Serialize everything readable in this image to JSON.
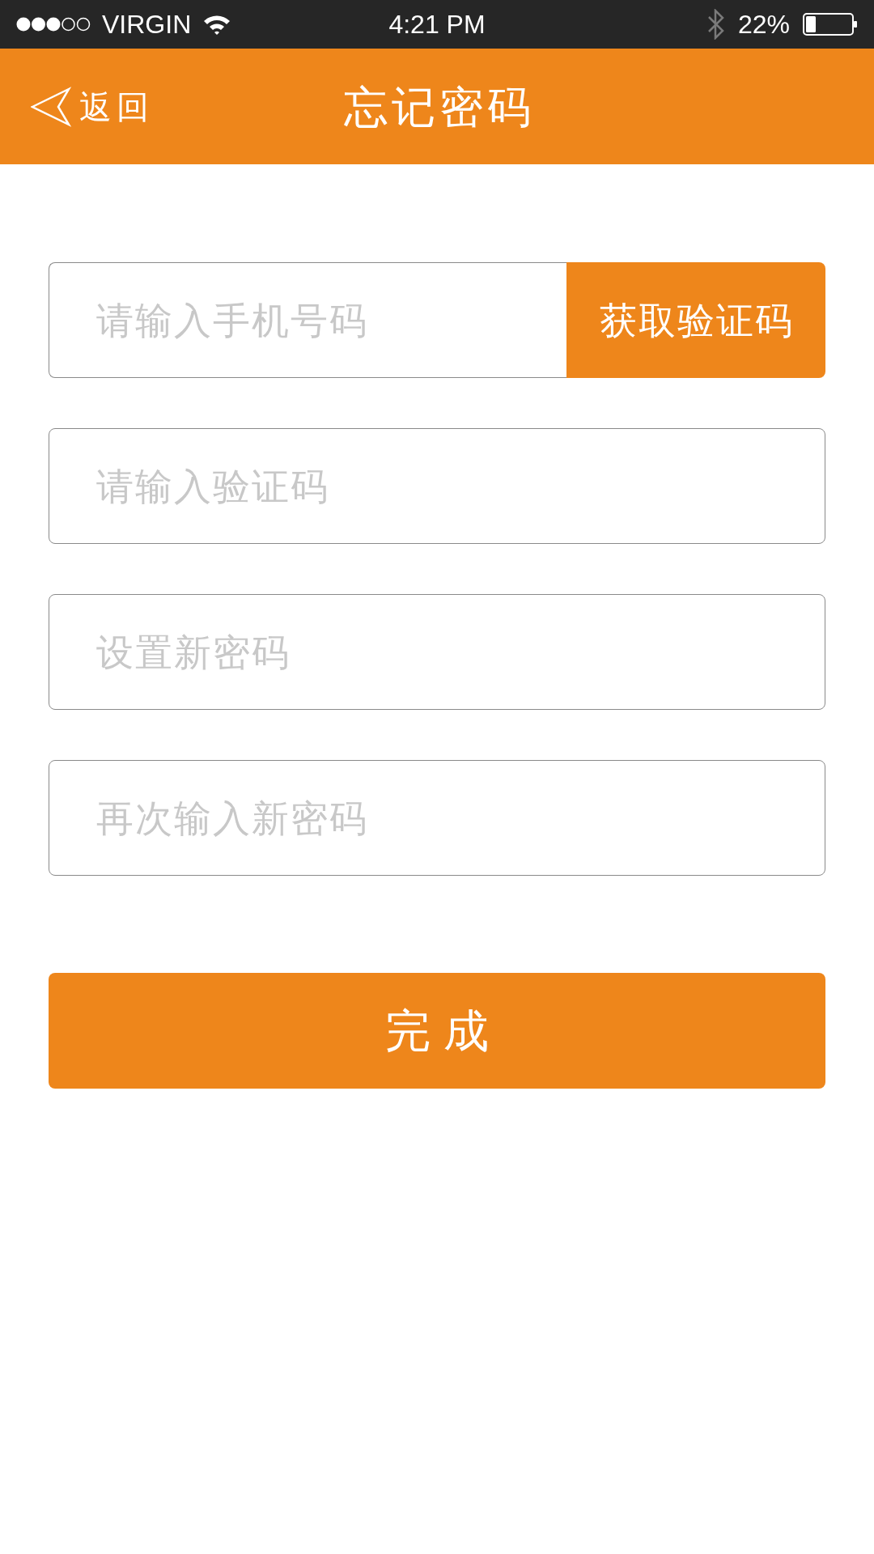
{
  "status_bar": {
    "carrier": "VIRGIN",
    "time": "4:21 PM",
    "battery": "22%"
  },
  "nav_bar": {
    "back": "返回",
    "title": "忘记密码"
  },
  "form": {
    "fields": [
      {
        "placeholder": "请输入手机号码",
        "button": "获取验证码"
      },
      {
        "placeholder": "请输入验证码"
      },
      {
        "placeholder": "设置新密码"
      },
      {
        "placeholder": "再次输入新密码"
      }
    ],
    "submit": "完成"
  }
}
